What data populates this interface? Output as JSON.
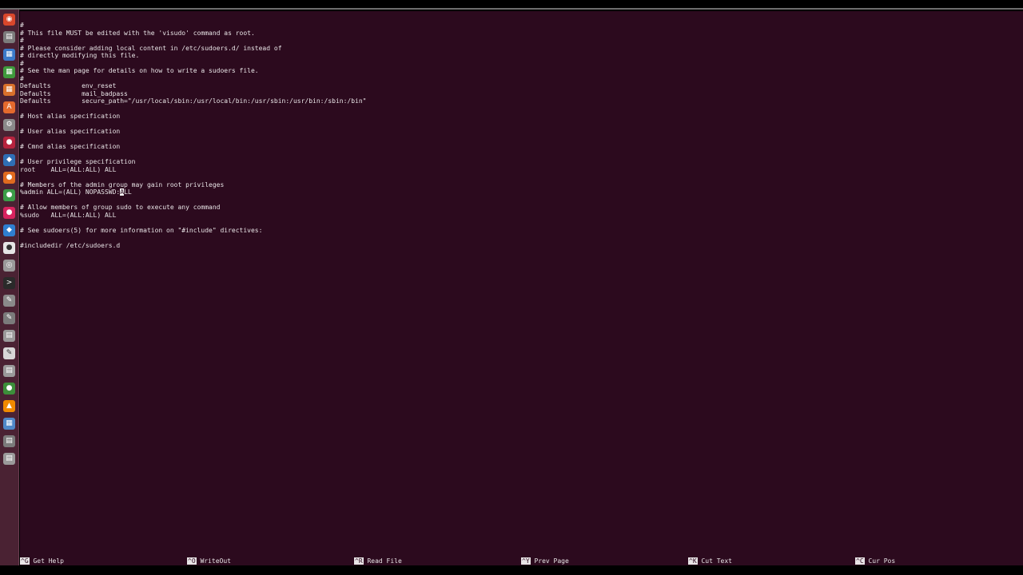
{
  "launcher": {
    "icons": [
      {
        "name": "dash-icon",
        "color": "#d9472b",
        "glyph": "◉"
      },
      {
        "name": "files-icon",
        "color": "#7c7c7c",
        "glyph": "▤"
      },
      {
        "name": "document-icon",
        "color": "#3b7ac9",
        "glyph": "▦"
      },
      {
        "name": "spreadsheet-icon",
        "color": "#3f9a3c",
        "glyph": "▦"
      },
      {
        "name": "presentation-icon",
        "color": "#d9712b",
        "glyph": "▦"
      },
      {
        "name": "software-center-icon",
        "color": "#e46a2d",
        "glyph": "A"
      },
      {
        "name": "settings-icon",
        "color": "#8a8a8a",
        "glyph": "⚙"
      },
      {
        "name": "app-icon-red",
        "color": "#b6233e",
        "glyph": "●"
      },
      {
        "name": "virtualbox-icon",
        "color": "#2f6fb5",
        "glyph": "◆"
      },
      {
        "name": "firefox-icon",
        "color": "#e06b1f",
        "glyph": "●"
      },
      {
        "name": "chrome-icon",
        "color": "#3b9d48",
        "glyph": "●"
      },
      {
        "name": "app-icon-pink",
        "color": "#d8235f",
        "glyph": "●"
      },
      {
        "name": "vscode-icon",
        "color": "#2f7fd0",
        "glyph": "◆"
      },
      {
        "name": "app-icon-white",
        "color": "#e6e6e6",
        "glyph": "●"
      },
      {
        "name": "camera-icon",
        "color": "#9a9a9a",
        "glyph": "◎"
      },
      {
        "name": "terminal-icon",
        "color": "#2a2a2a",
        "glyph": ">"
      },
      {
        "name": "text-editor-icon",
        "color": "#8a8a8a",
        "glyph": "✎"
      },
      {
        "name": "tool-icon",
        "color": "#7b7b7b",
        "glyph": "✎"
      },
      {
        "name": "app-icon-grey",
        "color": "#9a9a9a",
        "glyph": "▤"
      },
      {
        "name": "notes-icon",
        "color": "#d7d7d7",
        "glyph": "✎"
      },
      {
        "name": "printer-icon",
        "color": "#9a9a9a",
        "glyph": "▤"
      },
      {
        "name": "app-icon-green",
        "color": "#3c8f3a",
        "glyph": "●"
      },
      {
        "name": "vlc-icon",
        "color": "#f08a00",
        "glyph": "▲"
      },
      {
        "name": "workspace-switcher-icon",
        "color": "#4f88c8",
        "glyph": "▦"
      },
      {
        "name": "app-icon-dark",
        "color": "#7b7b7b",
        "glyph": "▤"
      },
      {
        "name": "trash-icon",
        "color": "#9a9a9a",
        "glyph": "▤"
      }
    ]
  },
  "editor": {
    "lines": [
      "#",
      "# This file MUST be edited with the 'visudo' command as root.",
      "#",
      "# Please consider adding local content in /etc/sudoers.d/ instead of",
      "# directly modifying this file.",
      "#",
      "# See the man page for details on how to write a sudoers file.",
      "#",
      "Defaults        env_reset",
      "Defaults        mail_badpass",
      "Defaults        secure_path=\"/usr/local/sbin:/usr/local/bin:/usr/sbin:/usr/bin:/sbin:/bin\"",
      "",
      "# Host alias specification",
      "",
      "# User alias specification",
      "",
      "# Cmnd alias specification",
      "",
      "# User privilege specification",
      "root    ALL=(ALL:ALL) ALL",
      "",
      "# Members of the admin group may gain root privileges",
      "",
      "",
      "# Allow members of group sudo to execute any command",
      "%sudo   ALL=(ALL:ALL) ALL",
      "",
      "# See sudoers(5) for more information on \"#include\" directives:",
      "",
      "#includedir /etc/sudoers.d"
    ],
    "cursor_line": {
      "before": "%admin ALL=(ALL) NOPASSWD:",
      "cursor": "A",
      "after": "LL"
    }
  },
  "shortcuts": [
    {
      "key": "^G",
      "label": "Get Help"
    },
    {
      "key": "^O",
      "label": "WriteOut"
    },
    {
      "key": "^R",
      "label": "Read File"
    },
    {
      "key": "^Y",
      "label": "Prev Page"
    },
    {
      "key": "^K",
      "label": "Cut Text"
    },
    {
      "key": "^C",
      "label": "Cur Pos"
    }
  ]
}
